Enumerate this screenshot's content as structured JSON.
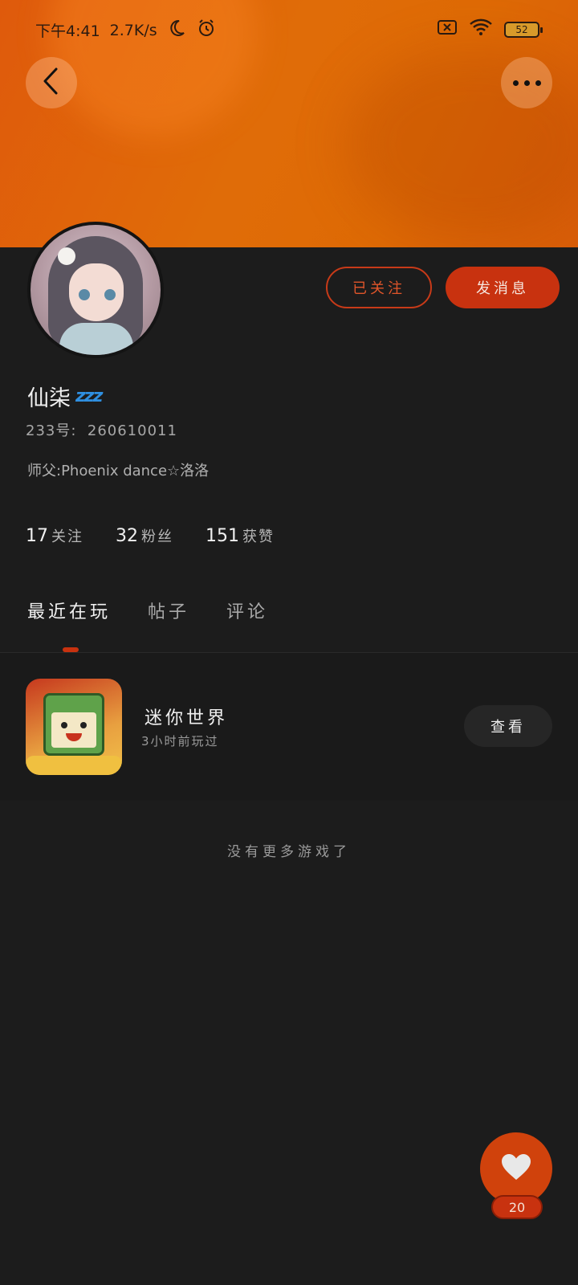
{
  "status_bar": {
    "time": "下午4:41",
    "speed": "2.7K/s",
    "battery": "52"
  },
  "profile": {
    "name": "仙柒",
    "name_emoji": "💤",
    "uid_label": "233号:",
    "uid_value": "260610011",
    "bio": "师父:Phoenix dance☆洛洛",
    "follow_button": "已关注",
    "message_button": "发消息",
    "stats": [
      {
        "value": "17",
        "label": "关注"
      },
      {
        "value": "32",
        "label": "粉丝"
      },
      {
        "value": "151",
        "label": "获赞"
      }
    ]
  },
  "tabs": [
    {
      "label": "最近在玩",
      "active": true
    },
    {
      "label": "帖子",
      "active": false
    },
    {
      "label": "评论",
      "active": false
    }
  ],
  "games": [
    {
      "name": "迷你世界",
      "subtitle": "3小时前玩过",
      "action": "查看"
    }
  ],
  "no_more_text": "没有更多游戏了",
  "like": {
    "count": "20"
  },
  "colors": {
    "accent": "#c8320f",
    "header": "#e06c08",
    "background": "#1c1c1c"
  },
  "icons": {
    "back": "back-arrow-icon",
    "more": "more-dots-icon",
    "like": "heart-icon"
  }
}
